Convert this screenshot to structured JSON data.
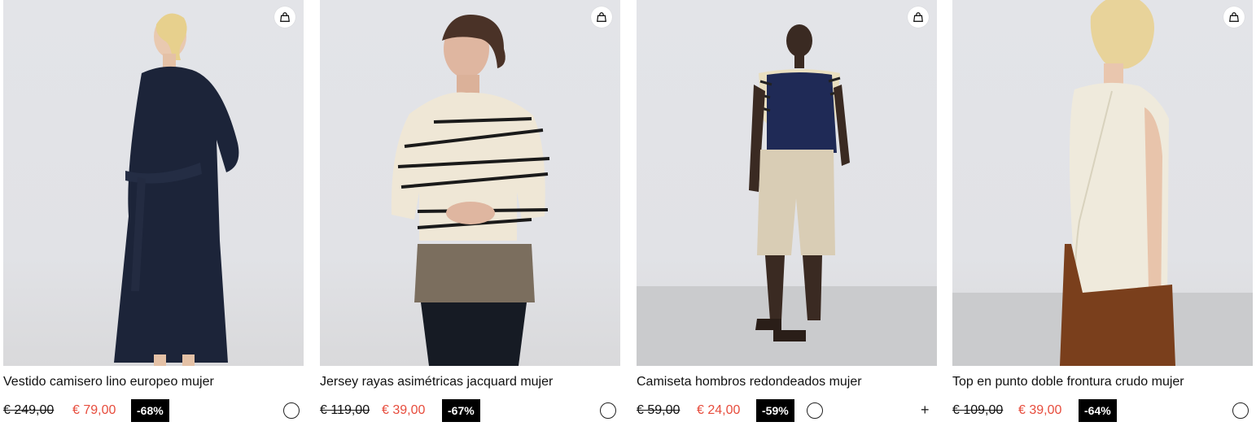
{
  "products": [
    {
      "title": "Vestido camisero lino europeo mujer",
      "old_price": "€ 249,00",
      "new_price": "€ 79,00",
      "discount": "-68%",
      "colors": [
        "#1b2236"
      ],
      "more_colors": "",
      "icon": "shopping-bag-icon"
    },
    {
      "title": "Jersey rayas asimétricas jacquard mujer",
      "old_price": "€ 119,00",
      "new_price": "€ 39,00",
      "discount": "-67%",
      "colors": [
        "#ece7d6"
      ],
      "more_colors": "",
      "icon": "shopping-bag-icon"
    },
    {
      "title": "Camiseta hombros redondeados mujer",
      "old_price": "€ 59,00",
      "new_price": "€ 24,00",
      "discount": "-59%",
      "colors": [
        "#1f2a56",
        "#c07a23",
        "#1a1a1a"
      ],
      "more_colors": "+",
      "icon": "shopping-bag-icon"
    },
    {
      "title": "Top en punto doble frontura crudo mujer",
      "old_price": "€ 109,00",
      "new_price": "€ 39,00",
      "discount": "-64%",
      "colors": [
        "#ecebe5"
      ],
      "more_colors": "",
      "icon": "shopping-bag-icon"
    }
  ],
  "colors": {
    "sale_price": "#e74c3c",
    "badge_bg": "#000000",
    "photo_backdrop": "#e3e4e8"
  }
}
